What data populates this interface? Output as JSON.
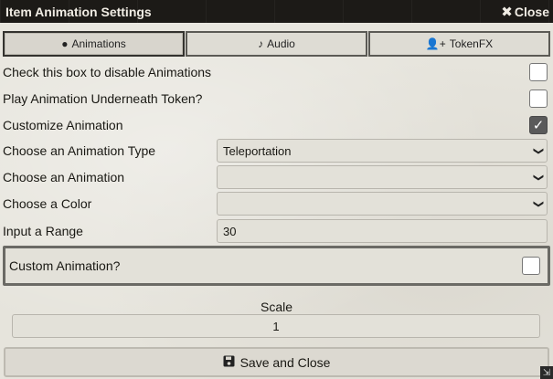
{
  "window": {
    "title": "Item Animation Settings",
    "close_label": "Close"
  },
  "tabs": [
    {
      "label": "Animations",
      "icon": "bomb-icon",
      "glyph": "●"
    },
    {
      "label": "Audio",
      "icon": "guitar-icon",
      "glyph": "♪"
    },
    {
      "label": "TokenFX",
      "icon": "user-plus-icon",
      "glyph": "👤+"
    }
  ],
  "settings": {
    "disable_label": "Check this box to disable Animations",
    "disable_checked": false,
    "below_label": "Play Animation Underneath Token?",
    "below_checked": false,
    "customize_label": "Customize Animation",
    "customize_checked": true,
    "type_label": "Choose an Animation Type",
    "type_value": "Teleportation",
    "animation_label": "Choose an Animation",
    "animation_value": "",
    "color_label": "Choose a Color",
    "color_value": "",
    "range_label": "Input a Range",
    "range_value": "30",
    "custom_label": "Custom Animation?",
    "custom_checked": false,
    "scale_label": "Scale",
    "scale_value": "1"
  },
  "footer": {
    "save_label": "Save and Close",
    "save_icon": "save-icon"
  }
}
